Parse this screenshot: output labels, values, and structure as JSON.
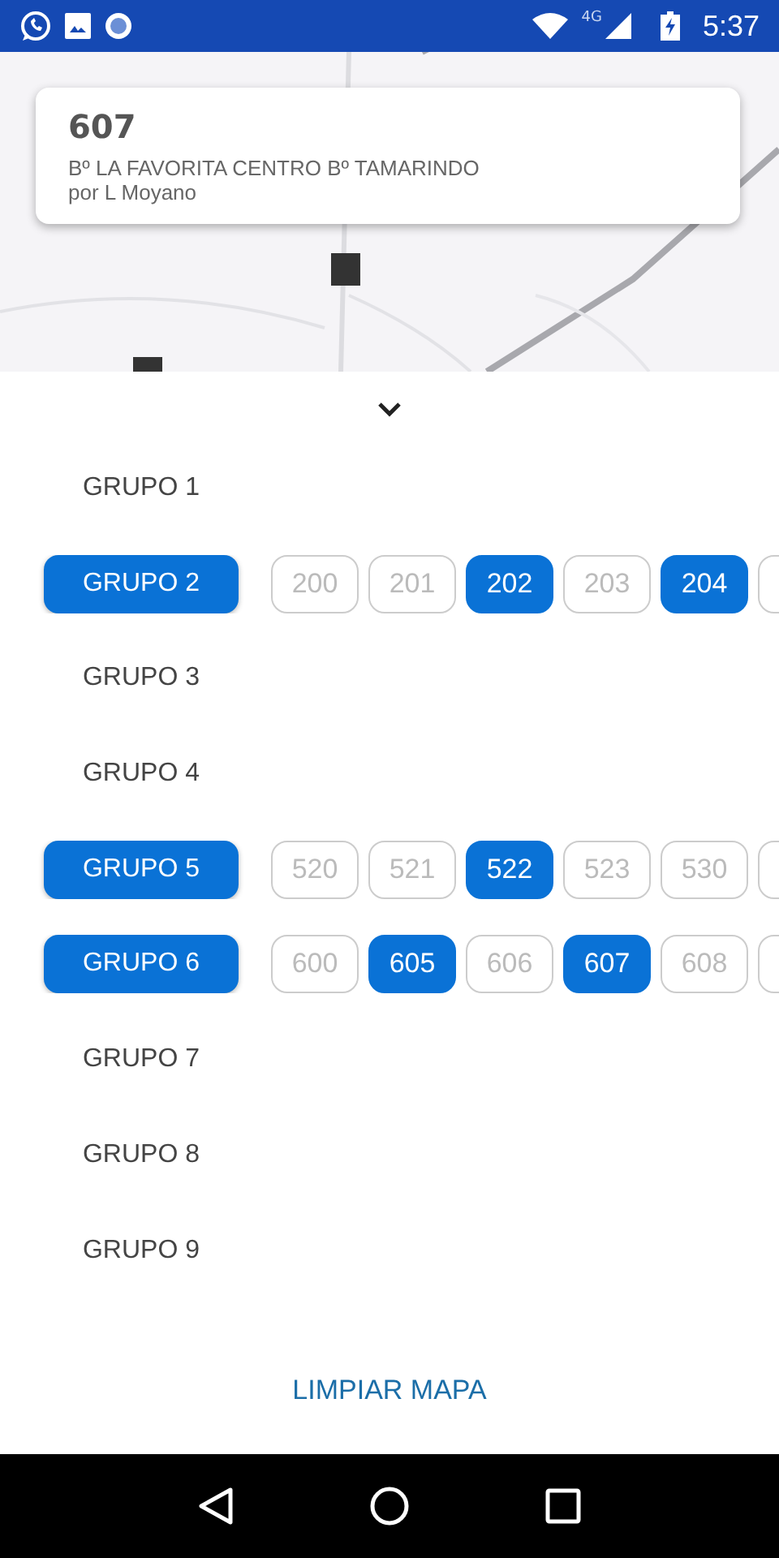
{
  "status_bar": {
    "network": "4G",
    "time": "5:37"
  },
  "route_card": {
    "number": "607",
    "name": "Bº LA FAVORITA CENTRO Bº TAMARINDO",
    "via": "por L Moyano"
  },
  "groups": [
    {
      "label": "GRUPO 1",
      "selected": false
    },
    {
      "label": "GRUPO 2",
      "selected": true,
      "more": true,
      "lines": [
        {
          "label": "200",
          "selected": false
        },
        {
          "label": "201",
          "selected": false
        },
        {
          "label": "202",
          "selected": true
        },
        {
          "label": "203",
          "selected": false
        },
        {
          "label": "204",
          "selected": true
        }
      ]
    },
    {
      "label": "GRUPO 3",
      "selected": false
    },
    {
      "label": "GRUPO 4",
      "selected": false
    },
    {
      "label": "GRUPO 5",
      "selected": true,
      "more": true,
      "lines": [
        {
          "label": "520",
          "selected": false
        },
        {
          "label": "521",
          "selected": false
        },
        {
          "label": "522",
          "selected": true
        },
        {
          "label": "523",
          "selected": false
        },
        {
          "label": "530",
          "selected": false
        }
      ]
    },
    {
      "label": "GRUPO 6",
      "selected": true,
      "more": true,
      "lines": [
        {
          "label": "600",
          "selected": false
        },
        {
          "label": "605",
          "selected": true
        },
        {
          "label": "606",
          "selected": false
        },
        {
          "label": "607",
          "selected": true
        },
        {
          "label": "608",
          "selected": false
        }
      ]
    },
    {
      "label": "GRUPO 7",
      "selected": false
    },
    {
      "label": "GRUPO 8",
      "selected": false
    },
    {
      "label": "GRUPO 9",
      "selected": false
    }
  ],
  "clear_button": "LIMPIAR MAPA"
}
